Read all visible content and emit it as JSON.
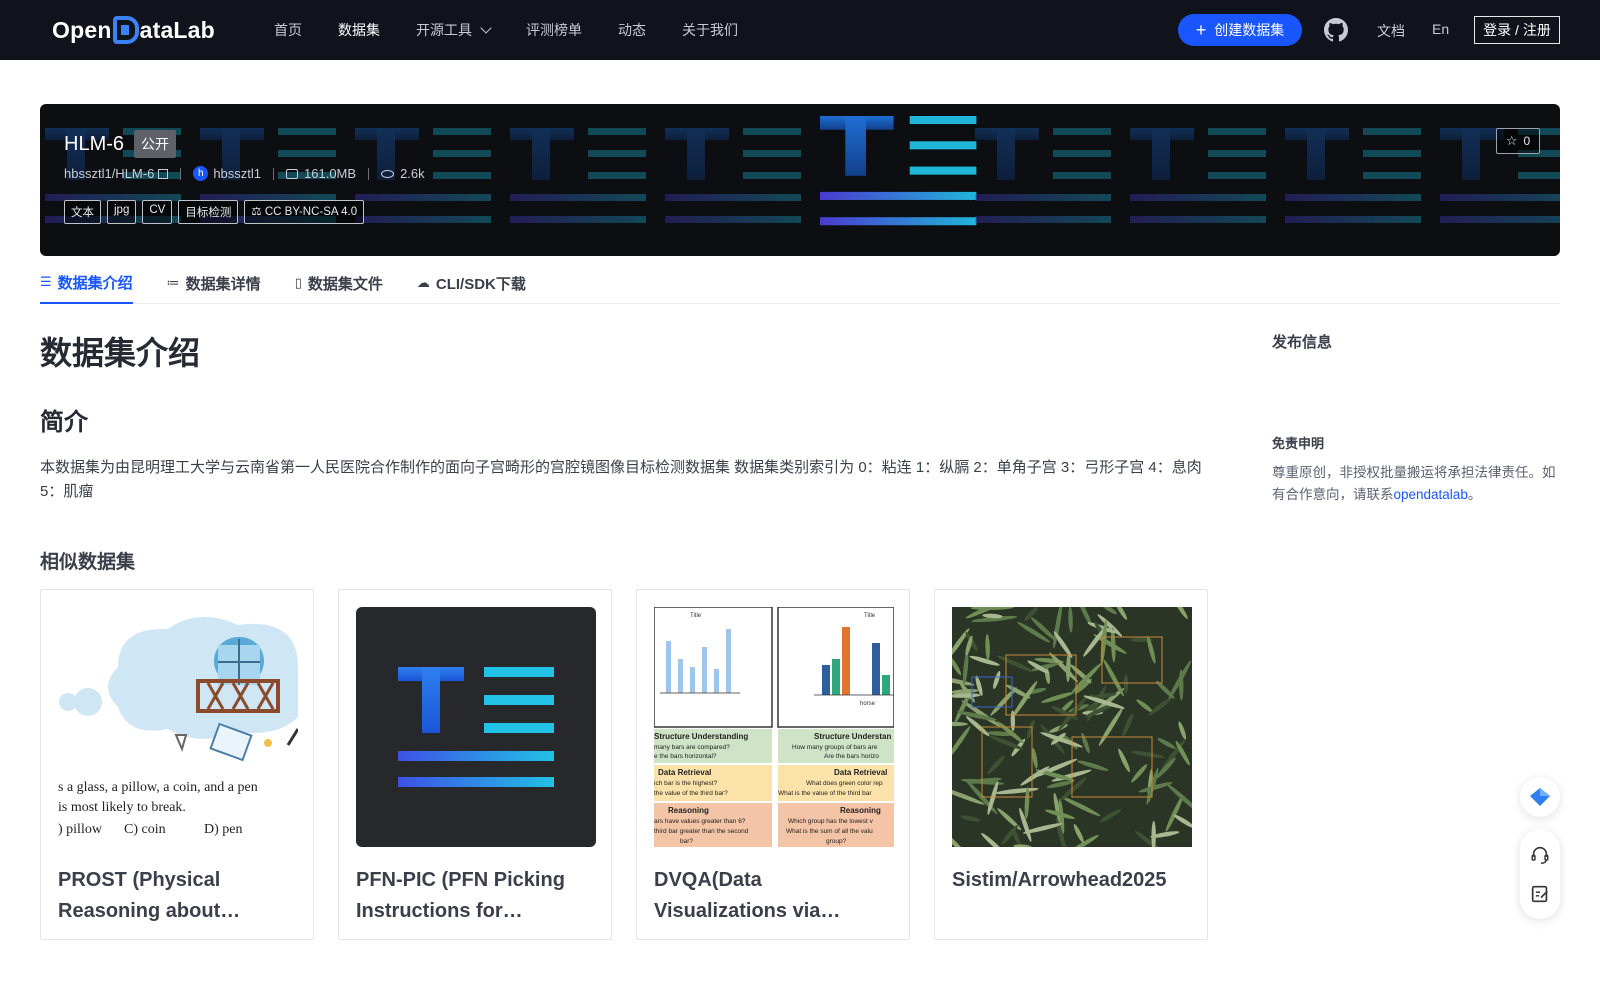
{
  "nav": {
    "logo_prefix": "Open",
    "logo_suffix": "ataLab",
    "links": [
      {
        "label": "首页"
      },
      {
        "label": "数据集"
      },
      {
        "label": "开源工具"
      },
      {
        "label": "评测榜单"
      },
      {
        "label": "动态"
      },
      {
        "label": "关于我们"
      }
    ],
    "create_label": "创建数据集",
    "docs_label": "文档",
    "lang_label": "En",
    "login_label": "登录 / 注册"
  },
  "hero": {
    "name": "HLM-6",
    "visibility": "公开",
    "repo": "hbssztl1/HLM-6",
    "author_initial": "h",
    "author": "hbssztl1",
    "size": "161.0MB",
    "views": "2.6k",
    "tags": [
      "文本",
      "jpg",
      "CV",
      "目标检测"
    ],
    "license": "CC BY-NC-SA 4.0",
    "stars": "0"
  },
  "tabs": [
    {
      "icon": "☰",
      "label": "数据集介绍"
    },
    {
      "icon": "≔",
      "label": "数据集详情"
    },
    {
      "icon": "▯",
      "label": "数据集文件"
    },
    {
      "icon": "☁",
      "label": "CLI/SDK下载"
    }
  ],
  "main": {
    "heading": "数据集介绍",
    "intro_heading": "简介",
    "description": "本数据集为由昆明理工大学与云南省第一人民医院合作制作的面向子宫畸形的宫腔镜图像目标检测数据集 数据集类别索引为 0：粘连 1：纵膈 2：单角子宫 3：弓形子宫 4：息肉 5：肌瘤",
    "similar_heading": "相似数据集",
    "cards": [
      {
        "title": "PROST (Physical Reasoning about…",
        "img_text": {
          "line1": "s a glass, a pillow, a coin, and a pen",
          "line2": "is most likely to break.",
          "opt1": ") pillow",
          "opt2": "C) coin",
          "opt3": "D) pen"
        }
      },
      {
        "title": "PFN-PIC (PFN Picking Instructions for…"
      },
      {
        "title": "DVQA(Data Visualizations via…",
        "img_text": {
          "title": "Title",
          "s1": "Structure Understanding",
          "s1a": "many bars are compared?",
          "s1b": "e the bars horizontal?",
          "s2": "Data Retrieval",
          "s2a": "ich bar is the highest?",
          "s2b": "the value of the third bar?",
          "s3": "Reasoning",
          "s3a": "ars have values greater than 6?",
          "s3b": "third bar greater than the second",
          "s3c": "bar?",
          "r1": "Structure Understan",
          "r1a": "How many groups of bars are",
          "r1b": "Are the bars horizo",
          "r2": "Data Retrieval",
          "r2a": "What does green color rep",
          "r2b": "What is the value of the third bar",
          "r3": "Reasoning",
          "r3a": "Which group has the lowest v",
          "r3b": "What is the sum of all the valu",
          "r3c": "group?",
          "xcat": "horse"
        }
      },
      {
        "title": "Sistim/Arrowhead2025"
      }
    ]
  },
  "sidebar": {
    "publish_heading": "发布信息",
    "disclaimer_heading": "免责申明",
    "disclaimer_text": "尊重原创，非授权批量搬运将承担法律责任。如有合作意向，请联系",
    "disclaimer_link": "opendatalab",
    "disclaimer_end": "。"
  },
  "colors": {
    "accent": "#1a56ff",
    "nav_bg": "#10131c",
    "hero_bg": "#0c0e12"
  },
  "icons": [
    "github-icon",
    "star-icon",
    "database-icon",
    "list-icon",
    "file-icon",
    "cloud-icon",
    "headset-icon",
    "edit-icon",
    "logo-mark-icon"
  ]
}
